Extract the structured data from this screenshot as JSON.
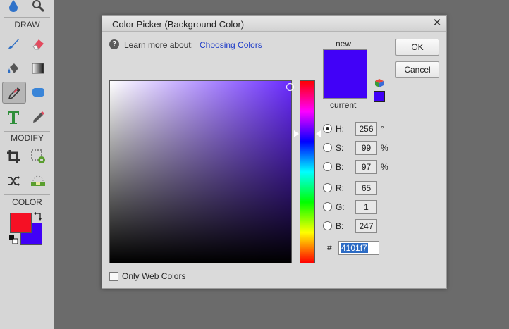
{
  "toolbox": {
    "sections": {
      "draw": "DRAW",
      "modify": "MODIFY",
      "color": "COLOR"
    },
    "foreground_color": "#f51024",
    "background_color": "#4101f7",
    "tools": [
      "blur-tool",
      "zoom-tool",
      "brush-tool",
      "eraser-tool",
      "paint-bucket-tool",
      "gradient-tool",
      "eyedropper-tool",
      "shape-tool",
      "type-tool",
      "pencil-tool",
      "crop-tool",
      "recompose-tool",
      "content-aware-move-tool",
      "straighten-tool"
    ]
  },
  "dialog": {
    "title": "Color Picker (Background Color)",
    "learn_more": "Learn more about:",
    "learn_link": "Choosing Colors",
    "new_label": "new",
    "current_label": "current",
    "new_color": "#4101f7",
    "current_color": "#4101f7",
    "ok_label": "OK",
    "cancel_label": "Cancel",
    "fields": {
      "h": {
        "label": "H:",
        "value": "256",
        "unit": "°",
        "selected": true
      },
      "s": {
        "label": "S:",
        "value": "99",
        "unit": "%"
      },
      "bri": {
        "label": "B:",
        "value": "97",
        "unit": "%"
      },
      "r": {
        "label": "R:",
        "value": "65"
      },
      "g": {
        "label": "G:",
        "value": "1"
      },
      "b": {
        "label": "B:",
        "value": "247"
      }
    },
    "hash": "#",
    "hex": "4101f7",
    "only_web_colors": "Only Web Colors"
  }
}
